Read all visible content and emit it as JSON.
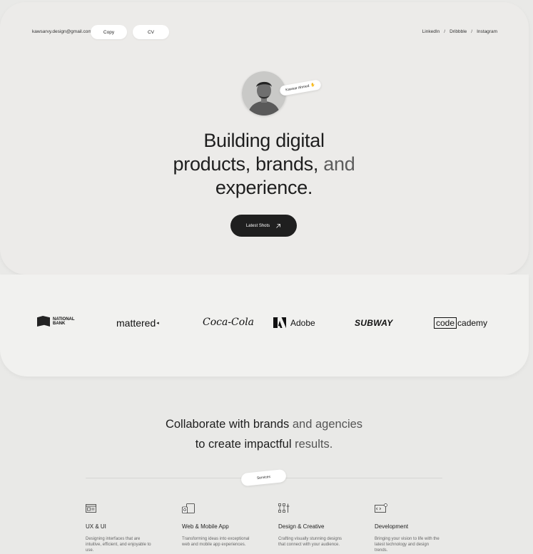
{
  "header": {
    "email": "kawsarvy.design@gmail.com",
    "copy_label": "Copy",
    "cv_label": "CV",
    "social": [
      "LinkedIn",
      "Dribbble",
      "Instagram"
    ],
    "separator": "/"
  },
  "hero": {
    "name_tag": "Kawsar Ahmed",
    "headline_line1": "Building digital",
    "headline_line2a": "products, brands,",
    "headline_line2b": " and",
    "headline_line3": "experience.",
    "cta_label": "Latest Shots",
    "cta_icon": "arrow-up-right-icon"
  },
  "logos": {
    "national_bank_line1": "NATIONAL",
    "national_bank_line2": "BANK",
    "mattered": "mattered",
    "cocacola": "Coca-Cola",
    "adobe": "Adobe",
    "subway": "SUBWAY",
    "codecademy_box": "code",
    "codecademy_rest": "cademy"
  },
  "collab": {
    "line1a": "Collaborate with brands",
    "line1b": " and agencies",
    "line2a": "to create impactful",
    "line2b": " results."
  },
  "services": {
    "tag": "Services",
    "items": [
      {
        "title": "UX & UI",
        "desc": "Designing interfaces that are intuitive, efficient, and enjoyable to use.",
        "icon": "browser-window-icon"
      },
      {
        "title": "Web & Mobile App",
        "desc": "Transforming ideas into exceptional web and mobile app experiences.",
        "icon": "devices-icon"
      },
      {
        "title": "Design & Creative",
        "desc": "Crafting visually stunning designs that connect with your audience.",
        "icon": "design-tools-icon"
      },
      {
        "title": "Development",
        "desc": "Bringing your vision to life with the latest technology and design trends.",
        "icon": "code-editor-icon"
      }
    ]
  },
  "colors": {
    "page_bg": "#e9e9e7",
    "cta_bg": "#1f1f1f",
    "text": "#1e1e1e"
  }
}
